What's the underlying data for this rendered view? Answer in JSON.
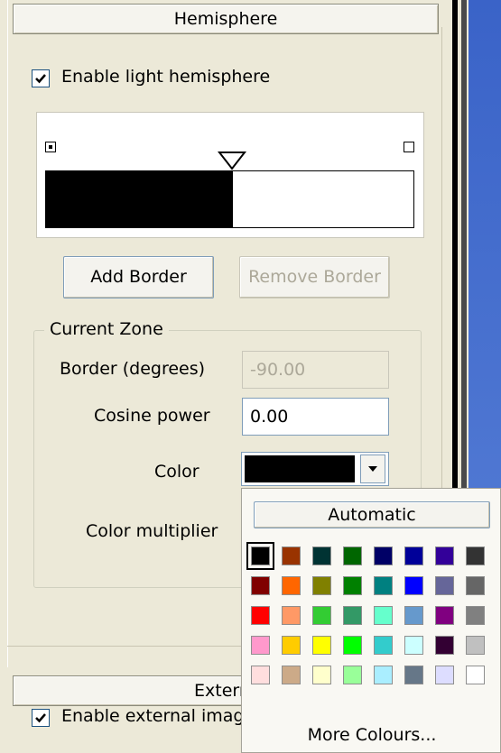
{
  "hemisphere": {
    "title": "Hemisphere",
    "enable_label": "Enable light hemisphere",
    "enable_checked": true
  },
  "buttons": {
    "add_border": "Add Border",
    "remove_border": "Remove Border"
  },
  "current_zone": {
    "title": "Current Zone",
    "border_label": "Border (degrees)",
    "border_value": "-90.00",
    "cosine_label": "Cosine power",
    "cosine_value": "0.00",
    "color_label": "Color",
    "color_value": "#000000",
    "multiplier_label": "Color multiplier"
  },
  "external": {
    "title": "Extern",
    "enable_label": "Enable external imag",
    "enable_checked": true
  },
  "color_popup": {
    "automatic_label": "Automatic",
    "more_label": "More Colours...",
    "colors": [
      [
        "#000000",
        "#993300",
        "#003333",
        "#006600",
        "#000066",
        "#000099",
        "#330099",
        "#333333"
      ],
      [
        "#800000",
        "#ff6600",
        "#808000",
        "#008000",
        "#008080",
        "#0000ff",
        "#666699",
        "#666666"
      ],
      [
        "#ff0000",
        "#ff9966",
        "#33cc33",
        "#339966",
        "#66ffcc",
        "#6699cc",
        "#800080",
        "#808080"
      ],
      [
        "#ff99cc",
        "#ffcc00",
        "#ffff00",
        "#00ff00",
        "#33cccc",
        "#ccffff",
        "#330033",
        "#c0c0c0"
      ],
      [
        "#ffdede",
        "#ccaa88",
        "#ffffcc",
        "#99ff99",
        "#aaeeff",
        "#667788",
        "#ddddff",
        "#ffffff"
      ]
    ]
  }
}
